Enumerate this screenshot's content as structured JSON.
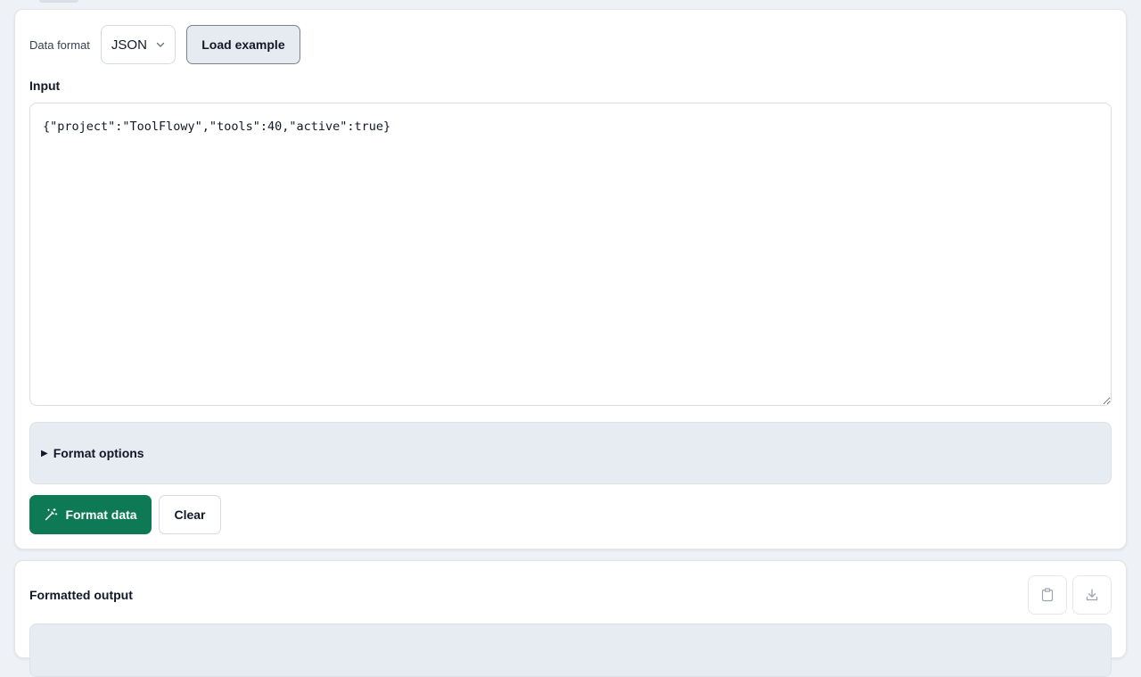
{
  "toolbar": {
    "format_label": "Data format",
    "format_selected": "JSON",
    "load_example_label": "Load example"
  },
  "input": {
    "label": "Input",
    "value": "{\"project\":\"ToolFlowy\",\"tools\":40,\"active\":true}"
  },
  "options": {
    "label": "Format options"
  },
  "actions": {
    "format_label": "Format data",
    "clear_label": "Clear"
  },
  "output": {
    "title": "Formatted output"
  },
  "colors": {
    "accent": "#0d7a55",
    "page_bg": "#eef1f6",
    "panel_bg": "#e7ebf2"
  },
  "icons": {
    "select_chevron": "chevron-down-icon",
    "format_button": "magic-wand-icon",
    "copy": "clipboard-icon",
    "download": "download-icon",
    "options_toggle": "triangle-right-icon"
  }
}
